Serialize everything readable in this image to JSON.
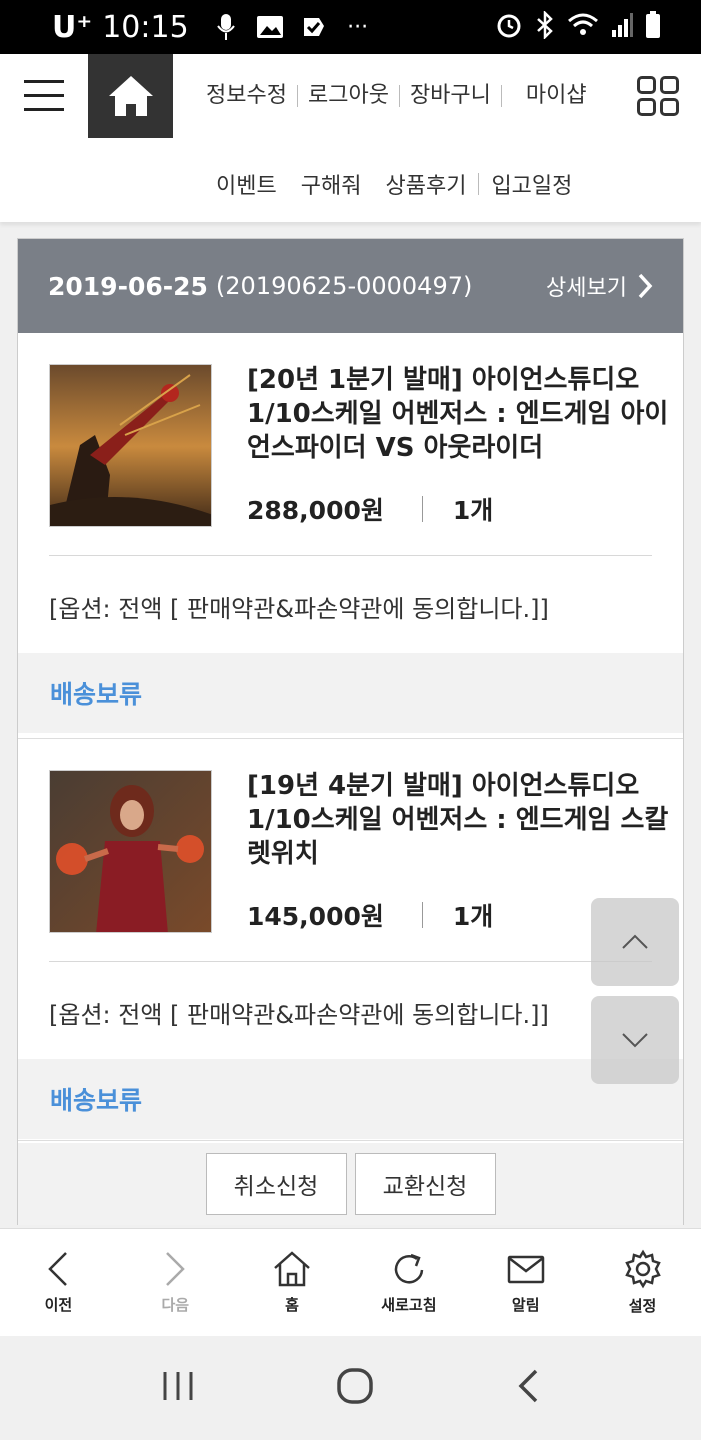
{
  "status_bar": {
    "carrier": "U⁺",
    "time": "10:15"
  },
  "header": {
    "top_nav": [
      "정보수정",
      "로그아웃",
      "장바구니",
      "마이샵"
    ],
    "sub_nav": [
      "이벤트",
      "구해줘",
      "상품후기",
      "입고일정"
    ]
  },
  "order": {
    "date": "2019-06-25",
    "number": "(20190625-0000497)",
    "detail_label": "상세보기",
    "items": [
      {
        "name": "[20년 1분기 발매] 아이언스튜디오 1/10스케일 어벤저스 : 엔드게임 아이언스파이더 VS 아웃라이더",
        "price": "288,000원",
        "qty": "1개",
        "option": "[옵션: 전액 [ 판매약관&파손약관에 동의합니다.]]",
        "status": "배송보류"
      },
      {
        "name": "[19년 4분기 발매] 아이언스튜디오 1/10스케일 어벤저스 : 엔드게임 스칼렛위치",
        "price": "145,000원",
        "qty": "1개",
        "option": "[옵션: 전액 [ 판매약관&파손약관에 동의합니다.]]",
        "status": "배송보류"
      }
    ],
    "buttons": {
      "cancel": "취소신청",
      "exchange": "교환신청"
    }
  },
  "toolbar": {
    "items": [
      {
        "label": "이전",
        "icon": "back-icon"
      },
      {
        "label": "다음",
        "icon": "forward-icon"
      },
      {
        "label": "홈",
        "icon": "home-icon"
      },
      {
        "label": "새로고침",
        "icon": "refresh-icon"
      },
      {
        "label": "알림",
        "icon": "mail-icon"
      },
      {
        "label": "설정",
        "icon": "gear-icon"
      }
    ]
  },
  "colors": {
    "order_header_bg": "#7a7f87",
    "status_text": "#4a90d9",
    "home_bg": "#333333"
  }
}
